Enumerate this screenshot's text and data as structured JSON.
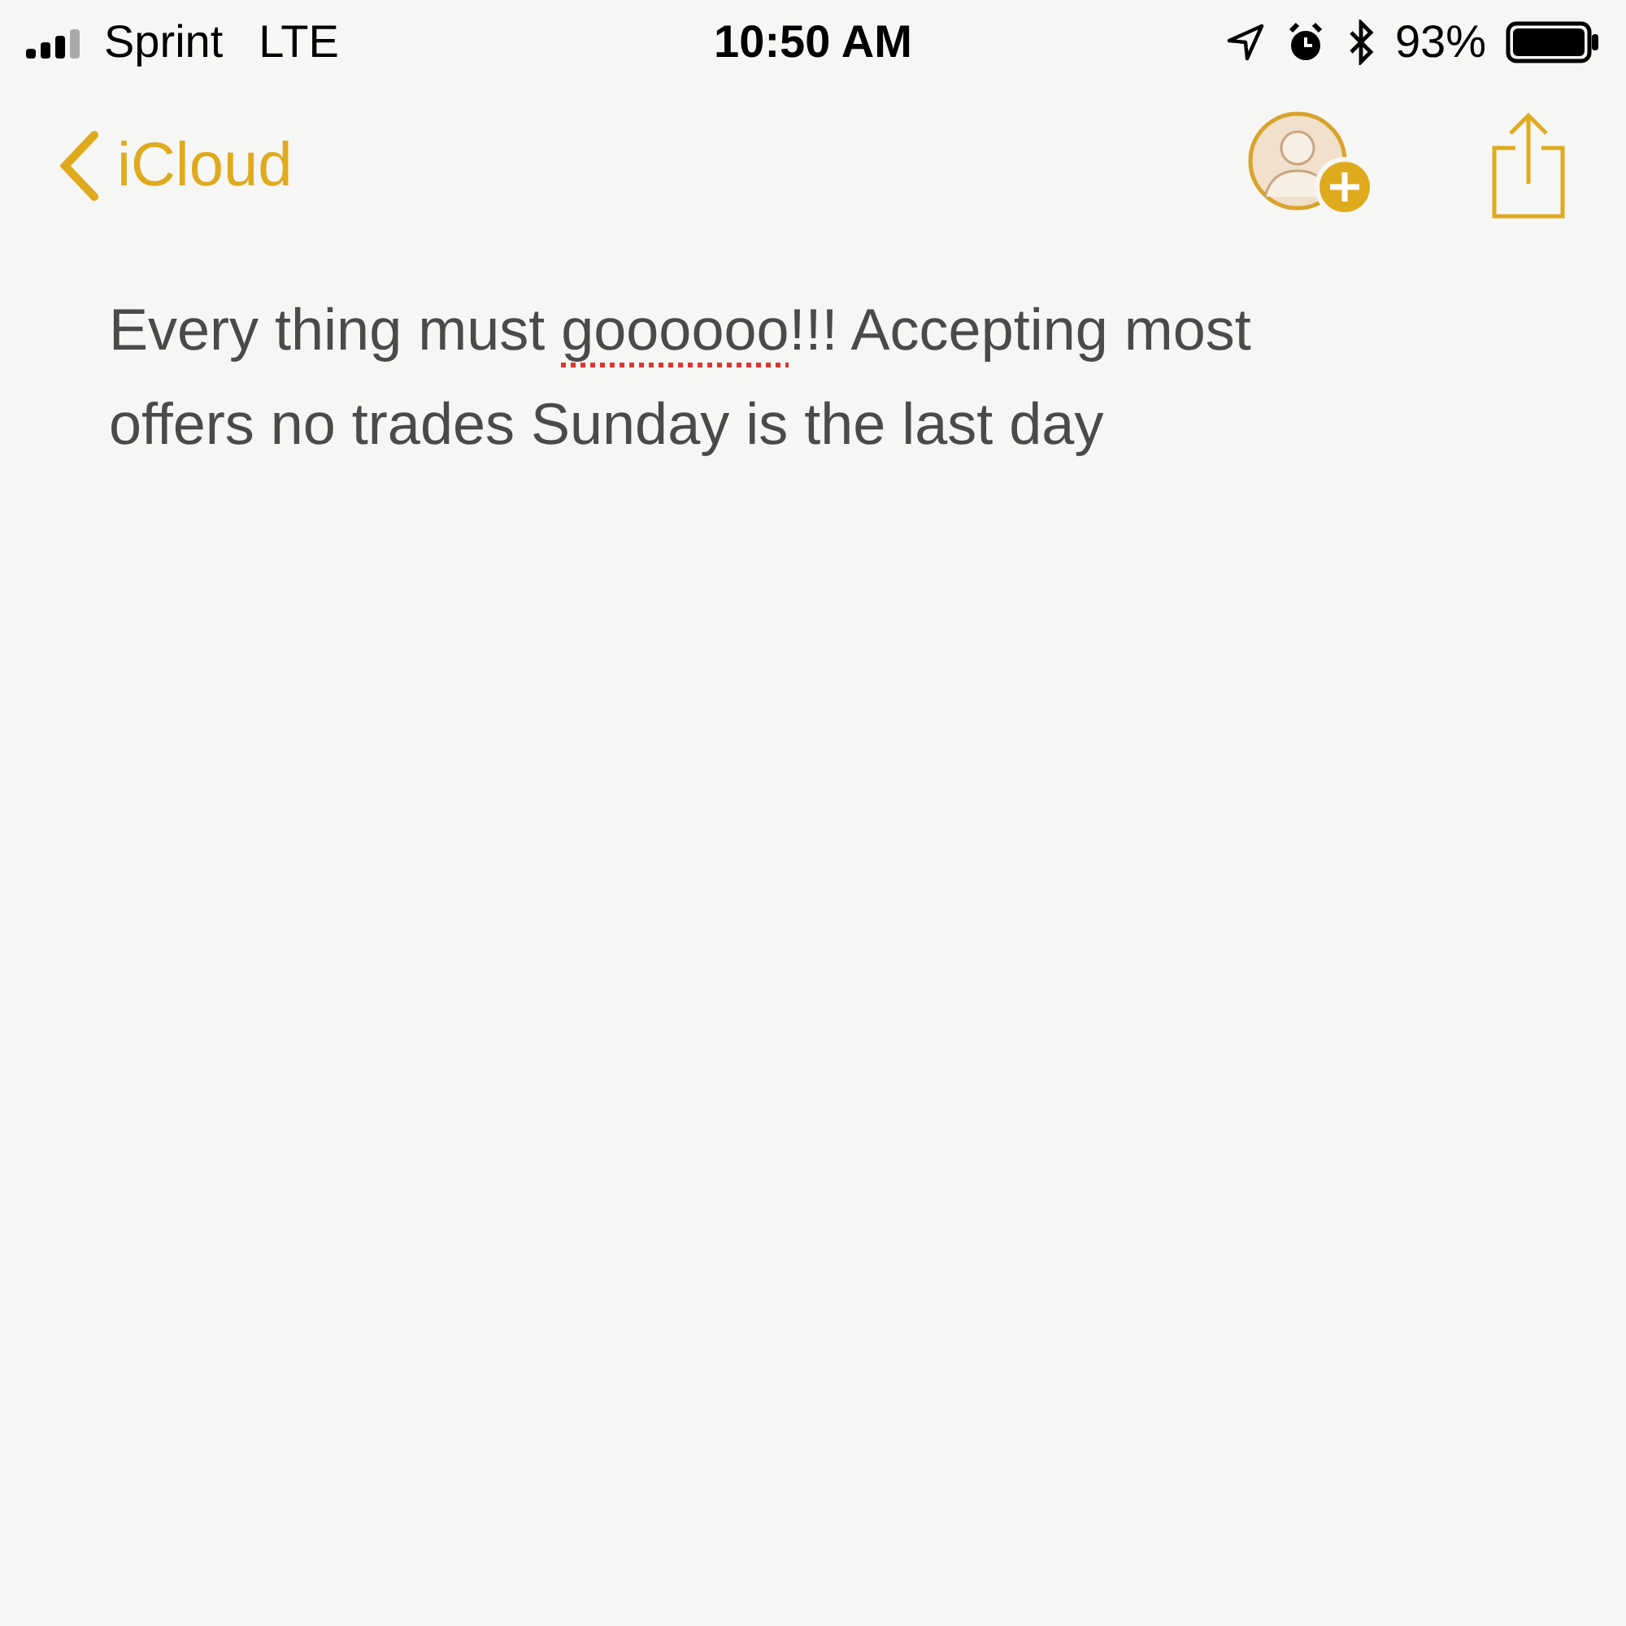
{
  "status_bar": {
    "carrier": "Sprint",
    "network": "LTE",
    "time": "10:50 AM",
    "battery_percent": "93%"
  },
  "nav_bar": {
    "back_label": "iCloud"
  },
  "note": {
    "segments": [
      {
        "text": "Every thing must ",
        "misspelled": false
      },
      {
        "text": "goooooo",
        "misspelled": true
      },
      {
        "text": "!!! Accepting most offers no trades Sunday is the last day",
        "misspelled": false
      }
    ]
  }
}
